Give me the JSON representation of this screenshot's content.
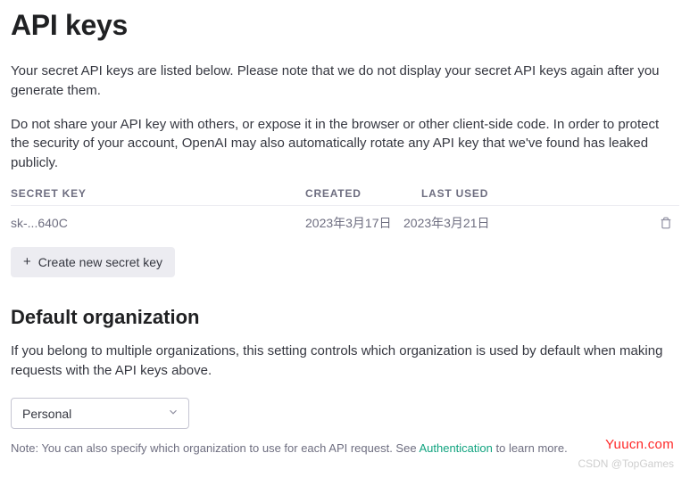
{
  "header": {
    "title": "API keys"
  },
  "intro": {
    "p1": "Your secret API keys are listed below. Please note that we do not display your secret API keys again after you generate them.",
    "p2": "Do not share your API key with others, or expose it in the browser or other client-side code. In order to protect the security of your account, OpenAI may also automatically rotate any API key that we've found has leaked publicly."
  },
  "table": {
    "headers": {
      "secret_key": "SECRET KEY",
      "created": "CREATED",
      "last_used": "LAST USED"
    },
    "rows": [
      {
        "secret_key": "sk-...640C",
        "created": "2023年3月17日",
        "last_used": "2023年3月21日"
      }
    ]
  },
  "actions": {
    "create_label": "Create new secret key"
  },
  "default_org": {
    "title": "Default organization",
    "description": "If you belong to multiple organizations, this setting controls which organization is used by default when making requests with the API keys above.",
    "selected": "Personal"
  },
  "note": {
    "prefix": "Note: You can also specify which organization to use for each API request. See ",
    "link_text": "Authentication",
    "suffix": " to learn more."
  },
  "watermarks": {
    "brand": "Yuucn.com",
    "csdn": "CSDN @TopGames"
  }
}
